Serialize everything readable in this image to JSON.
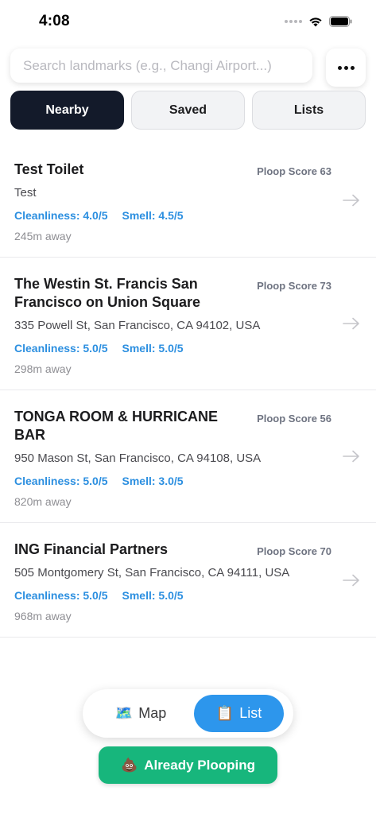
{
  "status_bar": {
    "time": "4:08"
  },
  "search": {
    "placeholder": "Search landmarks (e.g., Changi Airport...)",
    "value": ""
  },
  "tabs": [
    {
      "label": "Nearby",
      "active": true
    },
    {
      "label": "Saved",
      "active": false
    },
    {
      "label": "Lists",
      "active": false
    }
  ],
  "places": [
    {
      "name": "Test Toilet",
      "score": "Ploop Score 63",
      "address": "Test",
      "cleanliness": "Cleanliness: 4.0/5",
      "smell": "Smell: 4.5/5",
      "distance": "245m away"
    },
    {
      "name": "The Westin St. Francis San Francisco on Union Square",
      "score": "Ploop Score 73",
      "address": "335 Powell St, San Francisco, CA 94102, USA",
      "cleanliness": "Cleanliness: 5.0/5",
      "smell": "Smell: 5.0/5",
      "distance": "298m away"
    },
    {
      "name": "TONGA ROOM & HURRICANE BAR",
      "score": "Ploop Score 56",
      "address": "950 Mason St, San Francisco, CA 94108, USA",
      "cleanliness": "Cleanliness: 5.0/5",
      "smell": "Smell: 3.0/5",
      "distance": "820m away"
    },
    {
      "name": "ING Financial Partners",
      "score": "Ploop Score 70",
      "address": "505 Montgomery St, San Francisco, CA 94111, USA",
      "cleanliness": "Cleanliness: 5.0/5",
      "smell": "Smell: 5.0/5",
      "distance": "968m away"
    }
  ],
  "view_toggle": {
    "map_emoji": "🗺️",
    "map_label": "Map",
    "list_emoji": "📋",
    "list_label": "List"
  },
  "action": {
    "emoji": "💩",
    "label": "Already Plooping"
  },
  "colors": {
    "active_tab": "#131a2a",
    "rating_blue": "#2c8fe0",
    "toggle_active": "#2d96ec",
    "action_green": "#17b67c"
  }
}
